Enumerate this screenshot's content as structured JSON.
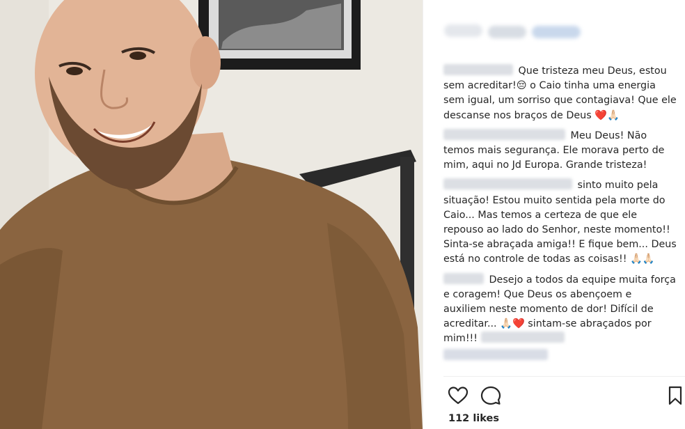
{
  "header": {
    "username_blurred": true
  },
  "comments": [
    {
      "text": "Que tristeza meu Deus, estou sem acreditar!😔 o Caio tinha uma energia sem igual, um sorriso que contagiava! Que ele descanse nos braços de Deus ❤️🙏🏻"
    },
    {
      "text": "Meu Deus! Não temos mais segurança. Ele morava perto de mim, aqui no Jd Europa. Grande tristeza!"
    },
    {
      "text": "sinto muito pela situação! Estou muito sentida pela morte do Caio... Mas temos a certeza de que ele repouso ao lado do Senhor, neste momento!! Sinta-se abraçada amiga!! E fique bem... Deus está no controle de todas as coisas!! 🙏🏻🙏🏻"
    },
    {
      "text": "Desejo a todos da equipe muita força e coragem! Que Deus os abençoem e auxiliem neste momento de dor! Difícil de acreditar... 🙏🏻❤️ sintam-se abraçados por mim!!!"
    }
  ],
  "likes": "112 likes",
  "icons": {
    "like": "heart-icon",
    "comment": "comment-bubble-icon",
    "save": "bookmark-icon"
  },
  "colors": {
    "text": "#262626",
    "divider": "#efefef",
    "shirt": "#8a6440"
  }
}
